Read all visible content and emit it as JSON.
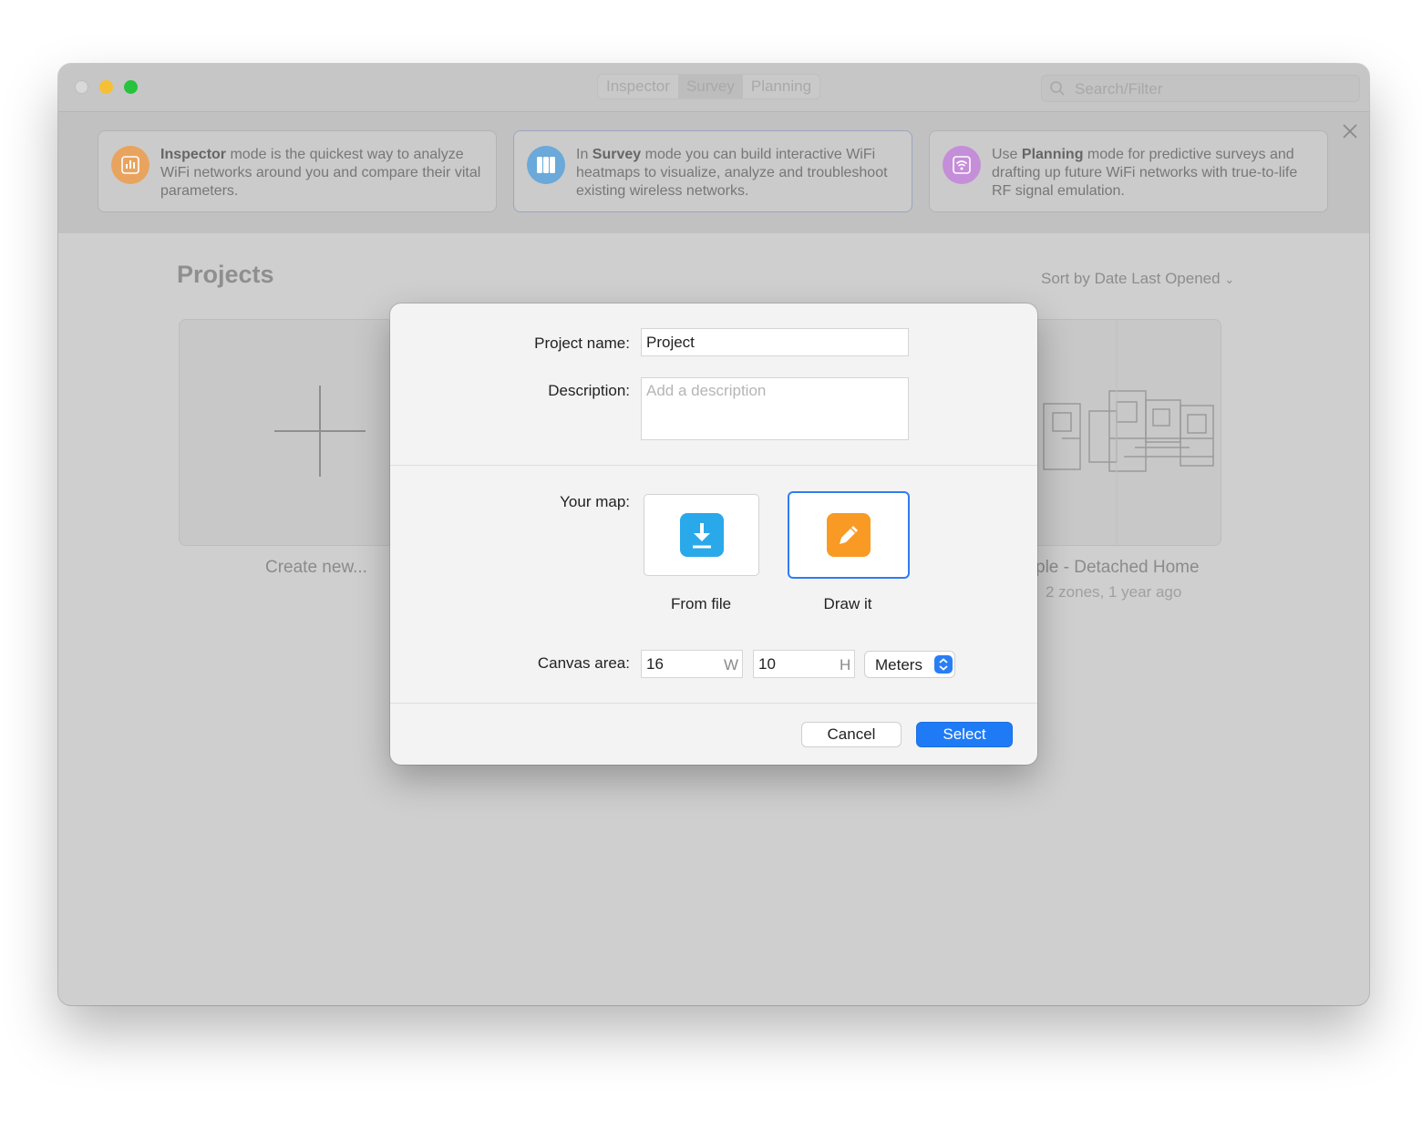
{
  "window": {
    "mode_tabs": [
      {
        "label": "Inspector",
        "active": false
      },
      {
        "label": "Survey",
        "active": true
      },
      {
        "label": "Planning",
        "active": false
      }
    ],
    "search": {
      "placeholder": "Search/Filter",
      "icon": "search-icon"
    }
  },
  "banner": {
    "cards": [
      {
        "mode": "Inspector",
        "text": " mode is the quickest way to analyze WiFi networks around you and compare their vital parameters.",
        "icon": "chart-icon",
        "color": "#e8a45f"
      },
      {
        "prefix": "In ",
        "mode": "Survey",
        "text": " mode you can build interactive WiFi heatmaps to visualize, analyze and troubleshoot existing wireless networks.",
        "icon": "map-icon",
        "color": "#6aa9d9"
      },
      {
        "prefix": "Use ",
        "mode": "Planning",
        "text": " mode for predictive surveys and drafting up future WiFi networks with true-to-life RF signal emulation.",
        "icon": "wifi-icon",
        "color": "#c58ed8"
      }
    ],
    "close_icon": "close-icon"
  },
  "projects": {
    "title": "Projects",
    "sort_label": "Sort by Date Last Opened",
    "create_label": "Create new...",
    "sample_label": "ple - Detached Home",
    "sample_sub": "2 zones, 1 year ago"
  },
  "dialog": {
    "project_name_label": "Project name:",
    "project_name_value": "Project",
    "description_label": "Description:",
    "description_placeholder": "Add a description",
    "your_map_label": "Your map:",
    "map_options": [
      {
        "label": "From file",
        "icon": "download-icon",
        "color": "#2aa9ea",
        "selected": false
      },
      {
        "label": "Draw it",
        "icon": "pencil-icon",
        "color": "#f89a24",
        "selected": true
      }
    ],
    "canvas_area_label": "Canvas area:",
    "canvas_width": "16",
    "canvas_width_unit": "W",
    "canvas_height": "10",
    "canvas_height_unit": "H",
    "units_value": "Meters",
    "cancel_label": "Cancel",
    "select_label": "Select",
    "accent": "#1f7bf5"
  }
}
